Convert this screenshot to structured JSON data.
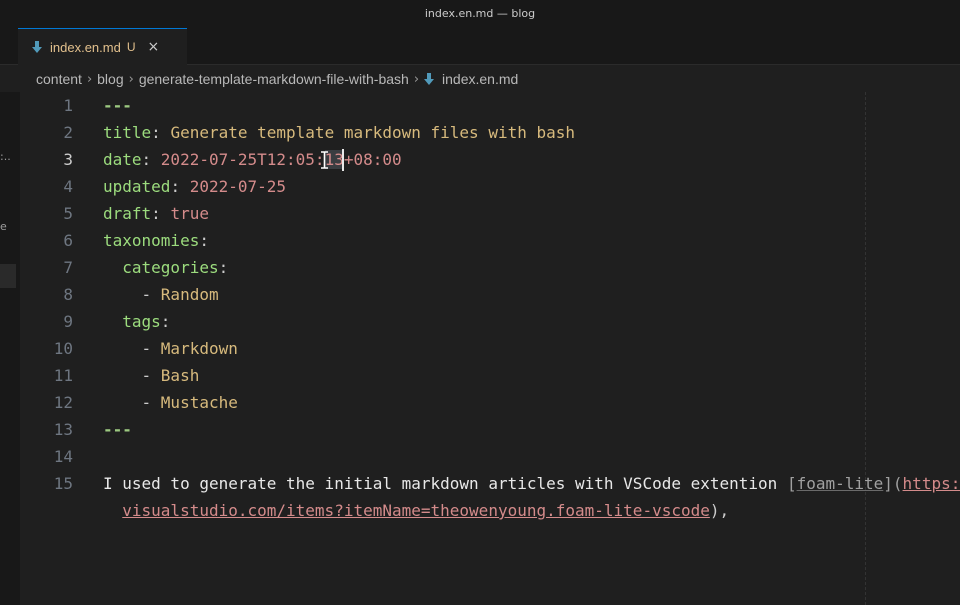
{
  "window": {
    "title": "index.en.md — blog"
  },
  "tab": {
    "label": "index.en.md",
    "status": "U",
    "close": "×"
  },
  "breadcrumb": [
    "content",
    "blog",
    "generate-template-markdown-file-with-bash",
    "index.en.md"
  ],
  "sidebar_glyphs": [
    ":..",
    "e"
  ],
  "editor": {
    "active_line": 3,
    "lines": [
      {
        "n": "1",
        "segs": [
          [
            "k",
            "---"
          ]
        ]
      },
      {
        "n": "2",
        "segs": [
          [
            "key",
            "title"
          ],
          [
            "c",
            ": "
          ],
          [
            "s",
            "Generate template markdown files with bash"
          ]
        ]
      },
      {
        "n": "3",
        "segs": [
          [
            "key",
            "date"
          ],
          [
            "c",
            ": "
          ],
          [
            "n",
            "2022-07-25T12:05:"
          ],
          [
            "n",
            "13",
            "sel"
          ],
          [
            "n",
            "+08:00"
          ]
        ]
      },
      {
        "n": "4",
        "segs": [
          [
            "key",
            "updated"
          ],
          [
            "c",
            ": "
          ],
          [
            "n",
            "2022-07-25"
          ]
        ]
      },
      {
        "n": "5",
        "segs": [
          [
            "key",
            "draft"
          ],
          [
            "c",
            ": "
          ],
          [
            "b",
            "true"
          ]
        ]
      },
      {
        "n": "6",
        "segs": [
          [
            "key",
            "taxonomies"
          ],
          [
            "c",
            ":"
          ]
        ]
      },
      {
        "n": "7",
        "segs": [
          [
            "c",
            "  "
          ],
          [
            "key",
            "categories"
          ],
          [
            "c",
            ":"
          ]
        ]
      },
      {
        "n": "8",
        "segs": [
          [
            "c",
            "    - "
          ],
          [
            "s",
            "Random"
          ]
        ]
      },
      {
        "n": "9",
        "segs": [
          [
            "c",
            "  "
          ],
          [
            "key",
            "tags"
          ],
          [
            "c",
            ":"
          ]
        ]
      },
      {
        "n": "10",
        "segs": [
          [
            "c",
            "    - "
          ],
          [
            "s",
            "Markdown"
          ]
        ]
      },
      {
        "n": "11",
        "segs": [
          [
            "c",
            "    - "
          ],
          [
            "s",
            "Bash"
          ]
        ]
      },
      {
        "n": "12",
        "segs": [
          [
            "c",
            "    - "
          ],
          [
            "s",
            "Mustache"
          ]
        ]
      },
      {
        "n": "13",
        "segs": [
          [
            "k",
            "---"
          ]
        ]
      },
      {
        "n": "14",
        "segs": []
      },
      {
        "n": "15",
        "segs": [
          [
            "t",
            "I used to generate the initial markdown articles with VSCode extention "
          ],
          [
            "brk",
            "["
          ],
          [
            "lnk-text",
            "foam-lite"
          ],
          [
            "brk",
            "]("
          ],
          [
            "url",
            "https:/"
          ]
        ]
      },
      {
        "n": "",
        "segs": [
          [
            "c",
            "  "
          ],
          [
            "url",
            "visualstudio.com/items?itemName=theowenyoung.foam-lite-vscode"
          ],
          [
            "p",
            "),"
          ]
        ]
      }
    ]
  },
  "colors": {
    "background": "#1f1f1f",
    "accent": "#0078d4",
    "modified": "#e2c08d"
  }
}
